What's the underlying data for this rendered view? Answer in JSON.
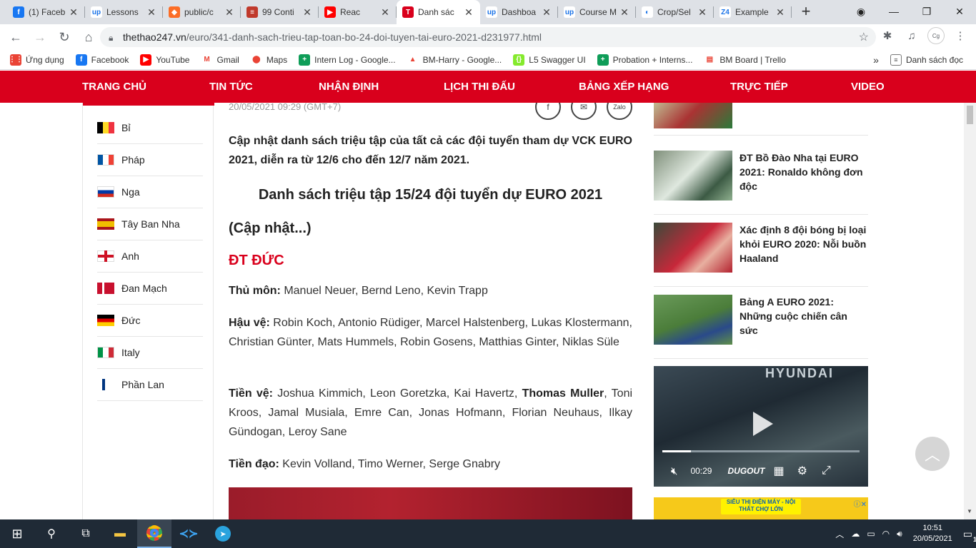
{
  "tabs": [
    {
      "title": "(1) Faceb",
      "icon": "facebook-icon",
      "color": "#1877f2",
      "glyph": "f"
    },
    {
      "title": "Lessons",
      "icon": "upwork-icon",
      "color": "#ffffff",
      "glyph": "up"
    },
    {
      "title": "public/c",
      "icon": "gitlab-icon",
      "color": "#fc6d26",
      "glyph": "◆"
    },
    {
      "title": "99 Conti",
      "icon": "list-icon",
      "color": "#c0392b",
      "glyph": "≡"
    },
    {
      "title": "Reac",
      "icon": "youtube-icon",
      "color": "#ff0000",
      "glyph": "▶"
    },
    {
      "title": "Danh sác",
      "icon": "thethao-icon",
      "color": "#d9001c",
      "glyph": "T",
      "active": true
    },
    {
      "title": "Dashboa",
      "icon": "upwork-icon",
      "color": "#ffffff",
      "glyph": "up"
    },
    {
      "title": "Course M",
      "icon": "upwork-icon",
      "color": "#ffffff",
      "glyph": "up"
    },
    {
      "title": "Crop/Sel",
      "icon": "crop-icon",
      "color": "#ffffff",
      "glyph": "◐"
    },
    {
      "title": "Example",
      "icon": "z4-icon",
      "color": "#ffffff",
      "glyph": "Z4"
    }
  ],
  "address": {
    "domain": "thethao247.vn",
    "path": "/euro/341-danh-sach-trieu-tap-toan-bo-24-doi-tuyen-tai-euro-2021-d231977.html"
  },
  "bookmarks": [
    {
      "label": "Ứng dụng",
      "icon": "apps-grid-icon",
      "color": "#ea4335",
      "glyph": "⋮⋮"
    },
    {
      "label": "Facebook",
      "icon": "facebook-icon",
      "color": "#1877f2",
      "glyph": "f"
    },
    {
      "label": "YouTube",
      "icon": "youtube-icon",
      "color": "#ff0000",
      "glyph": "▶"
    },
    {
      "label": "Gmail",
      "icon": "gmail-icon",
      "color": "#ffffff",
      "glyph": "M"
    },
    {
      "label": "Maps",
      "icon": "maps-pin-icon",
      "color": "#ffffff",
      "glyph": "⬤"
    },
    {
      "label": "Intern Log - Google...",
      "icon": "sheets-icon",
      "color": "#0f9d58",
      "glyph": "+"
    },
    {
      "label": "BM-Harry - Google...",
      "icon": "drive-icon",
      "color": "#ffffff",
      "glyph": "▲"
    },
    {
      "label": "L5 Swagger UI",
      "icon": "swagger-icon",
      "color": "#85ea2d",
      "glyph": "{}"
    },
    {
      "label": "Probation + Interns...",
      "icon": "sheets-icon",
      "color": "#0f9d58",
      "glyph": "+"
    },
    {
      "label": "BM Board | Trello",
      "icon": "trello-icon",
      "color": "#ffffff",
      "glyph": "▤"
    }
  ],
  "bookmarks_more": "»",
  "reading_list": "Danh sách đọc",
  "nav": [
    "TRANG CHỦ",
    "TIN TỨC",
    "NHẬN ĐỊNH",
    "LỊCH THI ĐẤU",
    "BẢNG XẾP HẠNG",
    "TRỰC TIẾP",
    "VIDEO"
  ],
  "teams": [
    {
      "name": "Bỉ",
      "flag": "belgium-flag"
    },
    {
      "name": "Pháp",
      "flag": "france-flag"
    },
    {
      "name": "Nga",
      "flag": "russia-flag"
    },
    {
      "name": "Tây Ban Nha",
      "flag": "spain-flag"
    },
    {
      "name": "Anh",
      "flag": "england-flag"
    },
    {
      "name": "Đan Mạch",
      "flag": "denmark-flag"
    },
    {
      "name": "Đức",
      "flag": "germany-flag"
    },
    {
      "name": "Italy",
      "flag": "italy-flag"
    },
    {
      "name": "Phần Lan",
      "flag": "finland-flag"
    }
  ],
  "article": {
    "meta": "20/05/2021 09:29 (GMT+7)",
    "lead": "Cập nhật danh sách triệu tập của tất cả các đội tuyển tham dự VCK EURO 2021, diễn ra từ 12/6 cho đến 12/7 năm 2021.",
    "heading": "Danh sách triệu tập 15/24 đội tuyển dự EURO 2021",
    "update": "(Cập nhật...)",
    "section": "ĐT ĐỨC",
    "gk_label": "Thủ môn:",
    "gk": " Manuel Neuer, Bernd Leno, Kevin Trapp",
    "df_label": "Hậu vệ:",
    "df": " Robin Koch, Antonio Rüdiger, Marcel Halstenberg, Lukas Klostermann, Christian Günter, Mats Hummels, Robin Gosens, Matthias Ginter, Niklas Süle",
    "mf_label": "Tiền vệ:",
    "mf_a": " Joshua Kimmich, Leon Goretzka, Kai Havertz, ",
    "mf_bold": "Thomas Muller",
    "mf_b": ", Toni Kroos, Jamal Musiala, Emre Can, Jonas Hofmann, Florian Neuhaus, Ilkay Gündogan, Leroy Sane",
    "fw_label": "Tiền đạo:",
    "fw": " Kevin Volland, Timo Werner, Serge Gnabry"
  },
  "news": [
    {
      "title": "ĐT Bồ Đào Nha tại EURO 2021: Ronaldo không đơn độc"
    },
    {
      "title": "Xác định 8 đội bóng bị loại khỏi EURO 2020: Nỗi buồn Haaland"
    },
    {
      "title": "Bảng A EURO 2021: Những cuộc chiến cân sức"
    }
  ],
  "video": {
    "brand": "HYUNDAI",
    "time": "00:29",
    "provider": "DUGOUT"
  },
  "ad": {
    "text": "SIÊU THỊ ĐIỆN MÁY - NỘI THẤT CHỢ LỚN"
  },
  "taskbar": {
    "time": "10:51",
    "date": "20/05/2021",
    "notifications": "1"
  }
}
